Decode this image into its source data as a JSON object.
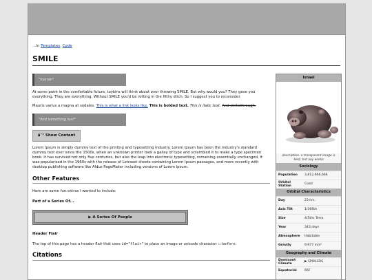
{
  "breadcrumb": {
    "prefix": "...In",
    "link1": "Templates",
    "sep": ",",
    "link2": "Code"
  },
  "page_title": "SMILE",
  "quote1": "\"hoorah\"",
  "para1": "At some point in the comfortable future, toykins will think about over throwing SMILE. But why would you? They gave you everything. They are everything. Without SMILE you'd be rotting in the filthy ditch. So I suggest you to reconsider.",
  "para2": {
    "text": "Mauris varius a magna at sodales.",
    "link": "This is what a link looks like.",
    "bold": "This is bolded text.",
    "italic": "This is italic text.",
    "strike": "And strikethrough."
  },
  "quote2": "\"find something fun?\"",
  "show_button": {
    "icon": "â˜°",
    "label": "Show Content"
  },
  "lorem": "Lorem Ipsum is simply dummy text of the printing and typesetting industry. Lorem Ipsum has been the industry's standard dummy text ever since the 1500s, when an unknown printer took a galley of type and scrambled it to make a type specimen book. It has survived not only five centuries, but also the leap into electronic typesetting, remaining essentially unchanged. It was popularised in the 1960s with the release of Letraset sheets containing Lorem Ipsum passages, and more recently with desktop publishing software like Aldus PageMaker including versions of Lorem Ipsum.",
  "other_features": {
    "heading": "Other Features",
    "intro": "Here are some fun extras I wanted to include:",
    "series_heading": "Part of a Series Of...",
    "series_box": "▶  A Series Of People",
    "flair_heading": "Header Flair",
    "flair_text1": "The top of this page has a header flair that uses",
    "flair_code1": "id=\"flair\"",
    "flair_text2": "to place an image or unicode character",
    "flair_code2": "::before",
    "flair_text3": "."
  },
  "citations_heading": "Citations",
  "infobox": {
    "title": "Ixnael",
    "caption": "description. a transparent image is best, but any works",
    "sociology_header": "Sociology",
    "sociology": [
      {
        "k": "Population",
        "v": "3,812,666,666"
      },
      {
        "k": "Orbital Station",
        "v": "Coati"
      }
    ],
    "orbital_header": "Orbital Characteristics",
    "orbital": [
      {
        "k": "Day",
        "v": "23 hrs."
      },
      {
        "k": "Axis Tilt",
        "v": "1/366th"
      },
      {
        "k": "Size",
        "v": "4/5ths Terra"
      },
      {
        "k": "Year",
        "v": "343 days"
      },
      {
        "k": "Atmosphere",
        "v": "Habitable"
      },
      {
        "k": "Gravity",
        "v": "9.977 m/s²"
      }
    ],
    "geo_header": "Geography and Climate",
    "geo": [
      {
        "k": "Dominant Climate",
        "v": "▶ SPOILERS"
      },
      {
        "k": "Equatorial",
        "v": "66F"
      }
    ]
  }
}
